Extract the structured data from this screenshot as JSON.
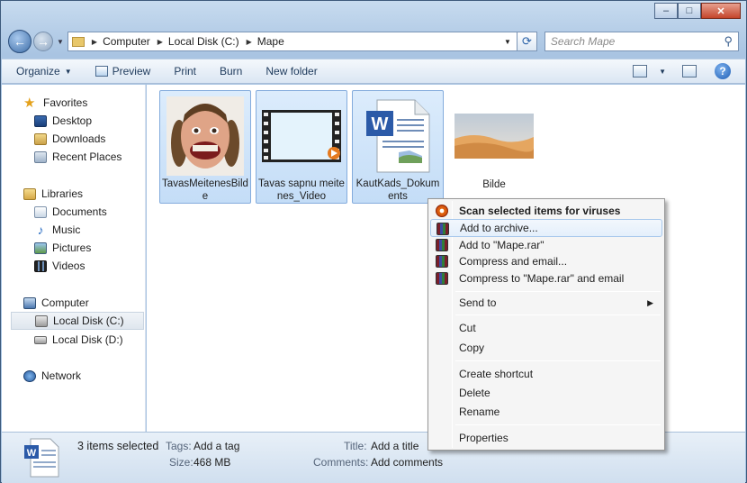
{
  "window": {
    "caption": {
      "minimize": "–",
      "maximize": "□",
      "close": "✕"
    }
  },
  "address": {
    "crumbs": [
      "Computer",
      "Local Disk (C:)",
      "Mape"
    ],
    "search_placeholder": "Search Mape"
  },
  "toolbar": {
    "organize": "Organize",
    "preview": "Preview",
    "print": "Print",
    "burn": "Burn",
    "new_folder": "New folder"
  },
  "nav": {
    "favorites": "Favorites",
    "desktop": "Desktop",
    "downloads": "Downloads",
    "recent_places": "Recent Places",
    "libraries": "Libraries",
    "documents": "Documents",
    "music": "Music",
    "pictures": "Pictures",
    "videos": "Videos",
    "computer": "Computer",
    "local_c": "Local Disk (C:)",
    "local_d": "Local Disk (D:)",
    "network": "Network"
  },
  "files": [
    {
      "label": "TavasMeitenesBilde"
    },
    {
      "label": "Tavas sapnu meitenes_Video"
    },
    {
      "label": "KautKads_Dokuments"
    },
    {
      "label": "Bilde"
    }
  ],
  "context_menu": {
    "scan": "Scan selected items for viruses",
    "add_archive": "Add to archive...",
    "add_rar": "Add to \"Mape.rar\"",
    "compress_email": "Compress and email...",
    "compress_rar_email": "Compress to \"Mape.rar\" and email",
    "send_to": "Send to",
    "cut": "Cut",
    "copy": "Copy",
    "create_shortcut": "Create shortcut",
    "delete": "Delete",
    "rename": "Rename",
    "properties": "Properties"
  },
  "status": {
    "selected": "3 items selected",
    "tags_k": "Tags:",
    "tags_v": "Add a tag",
    "size_k": "Size:",
    "size_v": "468 MB",
    "title_k": "Title:",
    "title_v": "Add a title",
    "comments_k": "Comments:",
    "comments_v": "Add comments"
  }
}
